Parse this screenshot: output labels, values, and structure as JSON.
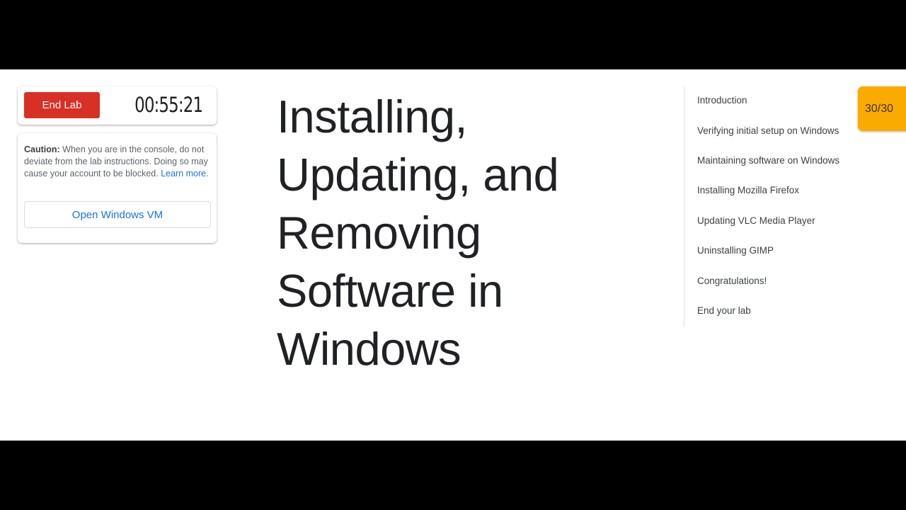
{
  "controls": {
    "end_lab_label": "End Lab",
    "timer": "00:55:21"
  },
  "caution": {
    "label": "Caution:",
    "text": "When you are in the console, do not deviate from the lab instructions. Doing so may cause your account to be blocked.",
    "learn_more": "Learn more.",
    "open_vm_label": "Open Windows VM"
  },
  "title": "Installing, Updating, and Removing Software in Windows",
  "toc": {
    "items": [
      "Introduction",
      "Verifying initial setup on Windows",
      "Maintaining software on Windows",
      "Installing Mozilla Firefox",
      "Updating VLC Media Player",
      "Uninstalling GIMP",
      "Congratulations!",
      "End your lab"
    ]
  },
  "score": "30/30",
  "colors": {
    "end_lab": "#d93025",
    "link": "#1a73e8",
    "score_badge": "#f9ab00"
  }
}
